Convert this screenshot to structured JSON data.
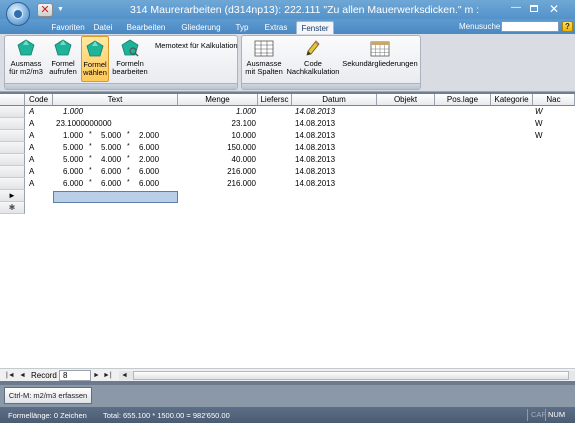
{
  "title": {
    "text": "314 Maurerarbeiten (d314np13): 222.111    \"Zu allen Mauerwerksdicken.\" m :"
  },
  "quick_access": {
    "close_glyph": "✕",
    "arrow_glyph": "▼"
  },
  "window_controls": {
    "minimize_glyph": "—",
    "close_glyph": "✕"
  },
  "tabs": [
    {
      "label": "Favoriten",
      "active": false
    },
    {
      "label": "Datei",
      "active": false
    },
    {
      "label": "Bearbeiten",
      "active": false
    },
    {
      "label": "Gliederung",
      "active": false
    },
    {
      "label": "Typ",
      "active": false
    },
    {
      "label": "Extras",
      "active": false
    },
    {
      "label": "Fenster",
      "active": true
    }
  ],
  "menusuche": {
    "label": "Menusuche",
    "value": "",
    "help_glyph": "?"
  },
  "ribbon": {
    "group1": {
      "buttons": [
        {
          "line1": "Ausmass",
          "line2": "für m2/m3",
          "icon": "teal-gem-icon",
          "active": false
        },
        {
          "line1": "Formel",
          "line2": "aufrufen",
          "icon": "teal-gem-icon",
          "active": false
        },
        {
          "line1": "Formel",
          "line2": "wählen",
          "icon": "teal-gem-icon",
          "active": true
        },
        {
          "line1": "Formeln",
          "line2": "bearbeiten",
          "icon": "teal-gem-search-icon",
          "active": false
        }
      ],
      "memotext_label": "Memotext für Kalkulation"
    },
    "group2": {
      "buttons": [
        {
          "line1": "Ausmasse",
          "line2": "mit Spalten",
          "icon": "columns-grid-icon"
        },
        {
          "line1": "Code",
          "line2": "Nachkalkulation",
          "icon": "pencil-icon"
        },
        {
          "line1": "Sekundärgliederungen",
          "line2": "",
          "icon": "calendar-grid-icon"
        }
      ]
    }
  },
  "grid": {
    "columns": [
      "Code",
      "Text",
      "Menge",
      "Liefersc",
      "Datum",
      "Objekt",
      "Pos.lage",
      "Kategorie",
      "Nac"
    ],
    "rows": [
      {
        "code": "A",
        "text": [
          "1.000",
          "",
          "",
          "",
          ""
        ],
        "menge": "1.000",
        "datum": "14.08.2013",
        "kategorie": "W",
        "italic": true
      },
      {
        "code": "A",
        "text": [
          "23.1000000000",
          "",
          "",
          "",
          ""
        ],
        "menge": "23.100",
        "datum": "14.08.2013",
        "kategorie": "W",
        "italic": false
      },
      {
        "code": "A",
        "text": [
          "1.000",
          "*",
          "5.000",
          "*",
          "2.000"
        ],
        "menge": "10.000",
        "datum": "14.08.2013",
        "kategorie": "W",
        "italic": false
      },
      {
        "code": "A",
        "text": [
          "5.000",
          "*",
          "5.000",
          "*",
          "6.000"
        ],
        "menge": "150.000",
        "datum": "14.08.2013",
        "kategorie": "",
        "italic": false
      },
      {
        "code": "A",
        "text": [
          "5.000",
          "*",
          "4.000",
          "*",
          "2.000"
        ],
        "menge": "40.000",
        "datum": "14.08.2013",
        "kategorie": "",
        "italic": false
      },
      {
        "code": "A",
        "text": [
          "6.000",
          "*",
          "6.000",
          "*",
          "6.000"
        ],
        "menge": "216.000",
        "datum": "14.08.2013",
        "kategorie": "",
        "italic": false
      },
      {
        "code": "A",
        "text": [
          "6.000",
          "*",
          "6.000",
          "*",
          "6.000"
        ],
        "menge": "216.000",
        "datum": "14.08.2013",
        "kategorie": "",
        "italic": false
      }
    ],
    "current_row_marker": "►",
    "new_row_marker": "✱"
  },
  "record_nav": {
    "first_glyph": "|◄",
    "prev_glyph": "◄",
    "label": "Record",
    "value": "8",
    "next_glyph": "►",
    "last_glyph": "►|",
    "new_glyph": "►✱",
    "scroll_left_glyph": "◄"
  },
  "tool_button": {
    "label": "Ctrl-M: m2/m3 erfassen"
  },
  "status": {
    "formellaenge": "Formellänge: 0 Zeichen",
    "total": "Total: 655.100 * 1500.00 = 982'650.00",
    "cap": "CAP",
    "num": "NUM"
  },
  "colors": {
    "title_blue": "#4f8ec7",
    "ribbon_active": "#ffc85a",
    "teal_icon": "#1fb39a",
    "status_bg": "#4a5b72"
  }
}
